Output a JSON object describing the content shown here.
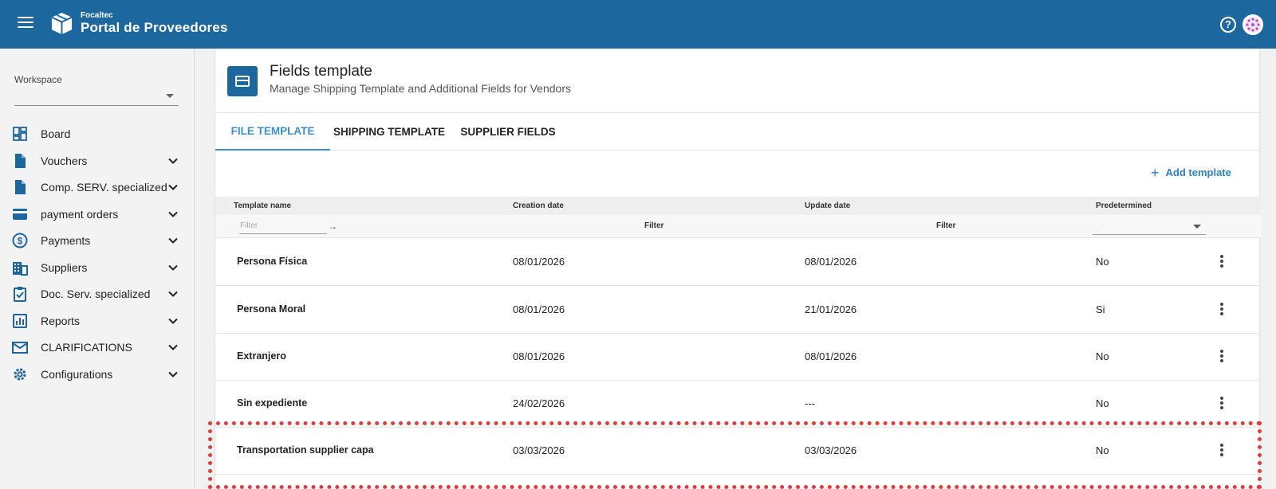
{
  "app": {
    "brand_small": "Focaltec",
    "brand_title": "Portal de Proveedores",
    "help_label": "?"
  },
  "sidebar": {
    "workspace_label": "Workspace",
    "workspace_value": "",
    "items": [
      {
        "label": "Board",
        "icon": "dashboard-icon",
        "expandable": false
      },
      {
        "label": "Vouchers",
        "icon": "document-icon",
        "expandable": true
      },
      {
        "label": "Comp. SERV. specialized",
        "icon": "document-icon",
        "expandable": true
      },
      {
        "label": "payment orders",
        "icon": "credit-card-icon",
        "expandable": true
      },
      {
        "label": "Payments",
        "icon": "dollar-circle-icon",
        "expandable": true
      },
      {
        "label": "Suppliers",
        "icon": "building-icon",
        "expandable": true
      },
      {
        "label": "Doc. Serv. specialized",
        "icon": "clipboard-check-icon",
        "expandable": true
      },
      {
        "label": "Reports",
        "icon": "bar-chart-icon",
        "expandable": true
      },
      {
        "label": "CLARIFICATIONS",
        "icon": "mail-icon",
        "expandable": true
      },
      {
        "label": "Configurations",
        "icon": "gear-icon",
        "expandable": true
      }
    ]
  },
  "header": {
    "title": "Fields template",
    "subtitle": "Manage Shipping Template and Additional Fields for Vendors"
  },
  "tabs": [
    {
      "label": "FILE TEMPLATE",
      "active": true
    },
    {
      "label": "SHIPPING TEMPLATE",
      "active": false
    },
    {
      "label": "SUPPLIER FIELDS",
      "active": false
    }
  ],
  "toolbar": {
    "add_label": "Add template"
  },
  "table": {
    "columns": [
      "Template name",
      "Creation date",
      "Update date",
      "Predetermined"
    ],
    "filters": {
      "name_placeholder": "Filter",
      "creation_label": "Filter",
      "update_label": "Filter",
      "predetermined_value": ""
    },
    "rows": [
      {
        "name": "Persona Física",
        "created": "08/01/2026",
        "updated": "08/01/2026",
        "predetermined": "No"
      },
      {
        "name": "Persona Moral",
        "created": "08/01/2026",
        "updated": "21/01/2026",
        "predetermined": "Si"
      },
      {
        "name": "Extranjero",
        "created": "08/01/2026",
        "updated": "08/01/2026",
        "predetermined": "No"
      },
      {
        "name": "Sin expediente",
        "created": "24/02/2026",
        "updated": "---",
        "predetermined": "No"
      },
      {
        "name": "Transportation supplier capa",
        "created": "03/03/2026",
        "updated": "03/03/2026",
        "predetermined": "No"
      }
    ]
  },
  "colors": {
    "brand": "#1c679e",
    "accent": "#3b8fd0",
    "highlight": "#e33b3b"
  }
}
